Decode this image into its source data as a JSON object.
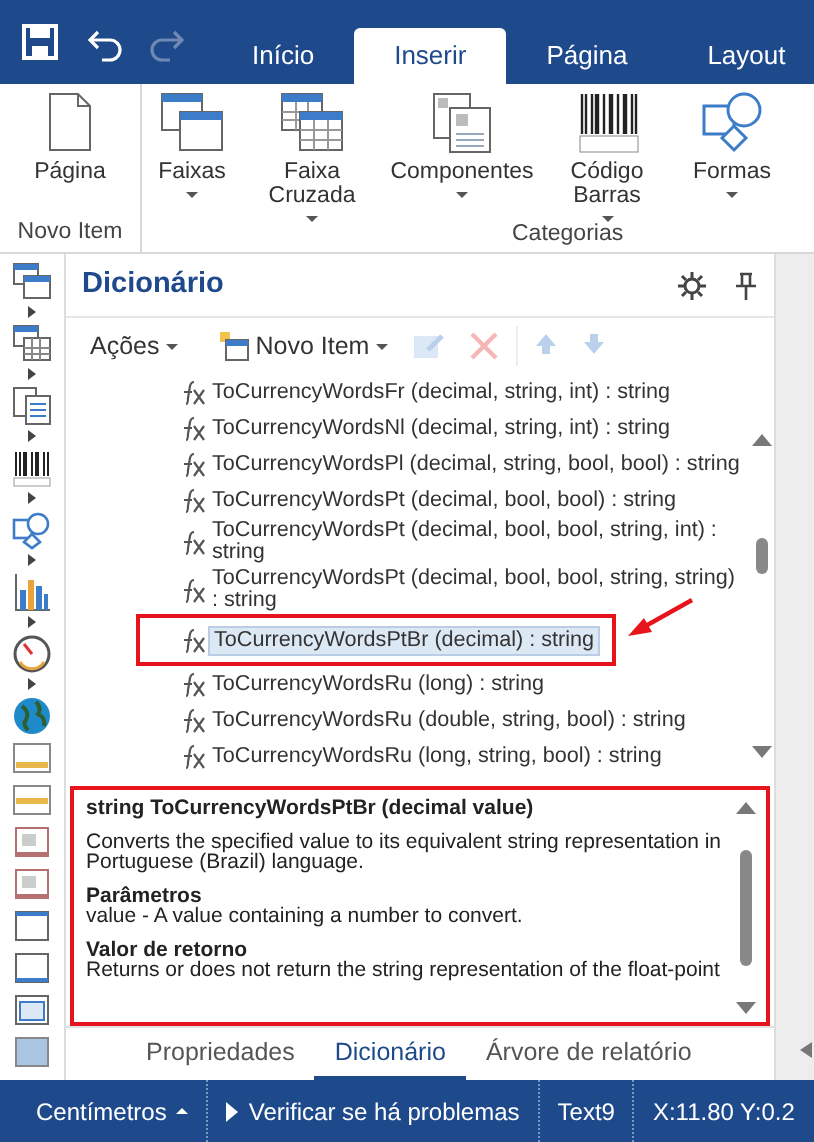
{
  "quick_access": [
    {
      "kind": "save",
      "disabled": false
    },
    {
      "kind": "undo",
      "disabled": false
    },
    {
      "kind": "redo",
      "disabled": true
    }
  ],
  "tabs": [
    {
      "label": "Início",
      "selected": false
    },
    {
      "label": "Inserir",
      "selected": true
    },
    {
      "label": "Página",
      "selected": false
    },
    {
      "label": "Layout",
      "selected": false
    }
  ],
  "ribbon": {
    "groups": [
      {
        "label": "Novo Item",
        "items": [
          {
            "kind": "page",
            "label": "Página",
            "dropdown": false
          }
        ]
      },
      {
        "label": "Categorias",
        "items": [
          {
            "kind": "bands",
            "label": "Faixas",
            "dropdown": true
          },
          {
            "kind": "crossbands",
            "label": "Faixa Cruzada",
            "dropdown": true
          },
          {
            "kind": "components",
            "label": "Componentes",
            "dropdown": true
          },
          {
            "kind": "barcode",
            "label": "Código Barras",
            "dropdown": true
          },
          {
            "kind": "shapes",
            "label": "Formas",
            "dropdown": true
          }
        ]
      }
    ]
  },
  "dictionary": {
    "title": "Dicionário",
    "toolbar": [
      {
        "kind": "actions",
        "label": "Ações",
        "dropdown": true,
        "disabled": false
      },
      {
        "kind": "new",
        "label": "Novo Item",
        "dropdown": true,
        "disabled": false
      },
      {
        "kind": "edit",
        "disabled": true
      },
      {
        "kind": "delete",
        "disabled": true
      },
      {
        "kind": "up",
        "disabled": true
      },
      {
        "kind": "down",
        "disabled": true
      }
    ],
    "items": [
      {
        "label": "ToCurrencyWordsFr (decimal, string, int) : string",
        "selected": false,
        "annotated": false
      },
      {
        "label": "ToCurrencyWordsNl (decimal, string, int) : string",
        "selected": false,
        "annotated": false
      },
      {
        "label": "ToCurrencyWordsPl (decimal, string, bool, bool) : string",
        "selected": false,
        "annotated": false
      },
      {
        "label": "ToCurrencyWordsPt (decimal, bool, bool) : string",
        "selected": false,
        "annotated": false
      },
      {
        "label": "ToCurrencyWordsPt (decimal, bool, bool, string, int) : string",
        "selected": false,
        "annotated": false
      },
      {
        "label": "ToCurrencyWordsPt (decimal, bool, bool, string, string) : string",
        "selected": false,
        "annotated": false
      },
      {
        "label": "ToCurrencyWordsPtBr (decimal) : string",
        "selected": true,
        "annotated": true
      },
      {
        "label": "ToCurrencyWordsRu (long) : string",
        "selected": false,
        "annotated": false
      },
      {
        "label": "ToCurrencyWordsRu (double, string, bool) : string",
        "selected": false,
        "annotated": false
      },
      {
        "label": "ToCurrencyWordsRu (long, string, bool) : string",
        "selected": false,
        "annotated": false
      }
    ],
    "description": {
      "annotated": true,
      "signature": "string ToCurrencyWordsPtBr (decimal value)",
      "summary": "Converts the specified value to its equivalent string representation in Portuguese (Brazil) language.",
      "params_heading": "Parâmetros",
      "params_text": "value - A value containing a number to convert.",
      "returns_heading": "Valor de retorno",
      "returns_text": "Returns or does not return the string representation of the float-point"
    }
  },
  "panel_tabs": [
    {
      "label": "Propriedades",
      "selected": false
    },
    {
      "label": "Dicionário",
      "selected": true
    },
    {
      "label": "Árvore de relatório",
      "selected": false
    }
  ],
  "status_bar": [
    {
      "kind": "units",
      "text": "Centímetros"
    },
    {
      "kind": "check",
      "text": "Verificar se há problemas"
    },
    {
      "kind": "plain",
      "text": "Text9"
    },
    {
      "kind": "plain",
      "text": "X:11.80 Y:0.2"
    }
  ]
}
